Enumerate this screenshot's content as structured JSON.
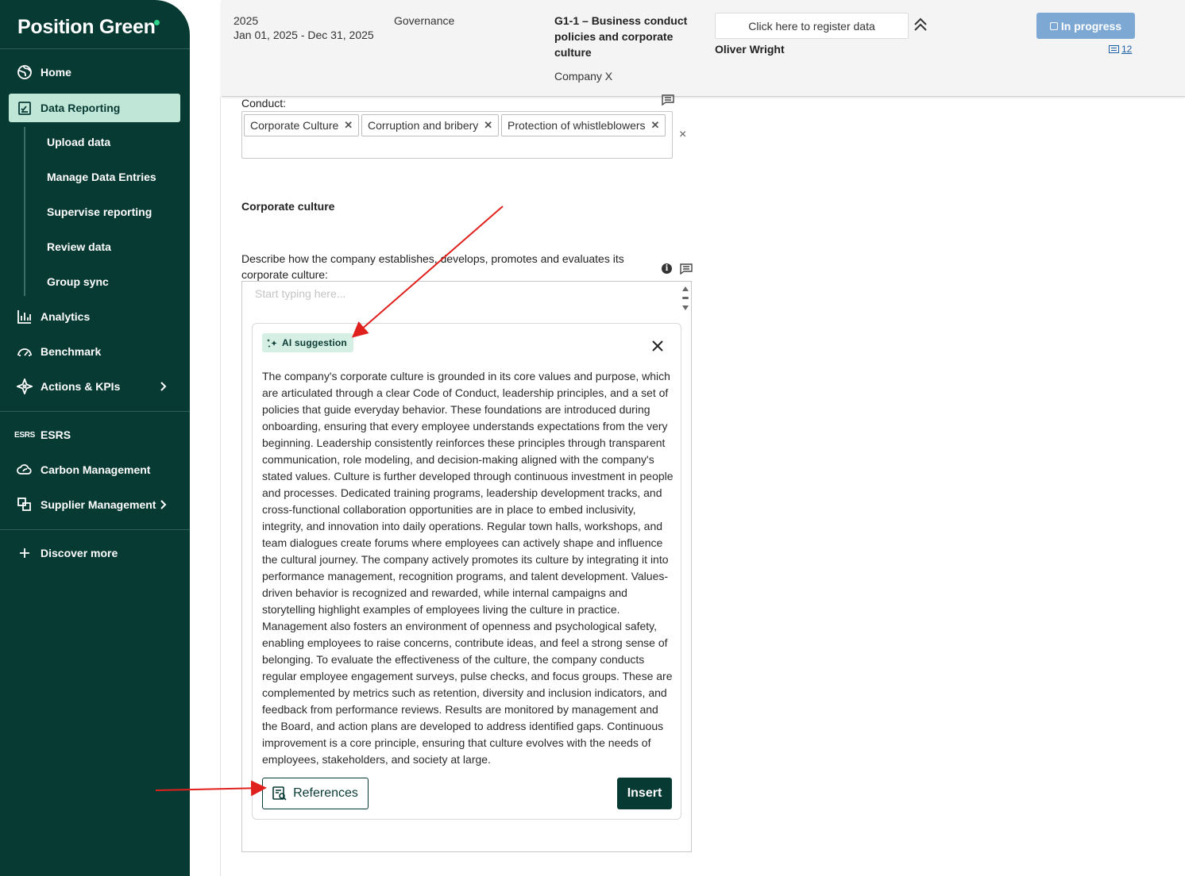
{
  "brand": {
    "name": "Position Green"
  },
  "nav": {
    "home": "Home",
    "data_reporting": "Data Reporting",
    "sub": [
      "Upload data",
      "Manage Data Entries",
      "Supervise reporting",
      "Review data",
      "Group sync"
    ],
    "analytics": "Analytics",
    "benchmark": "Benchmark",
    "actions": "Actions & KPIs",
    "esrs_mark": "ESRS",
    "esrs": "ESRS",
    "carbon": "Carbon Management",
    "supplier": "Supplier Management",
    "discover": "Discover more"
  },
  "header": {
    "year": "2025",
    "period": "Jan 01, 2025 - Dec 31, 2025",
    "topic": "Governance",
    "title": "G1-1 – Business conduct policies and corporate culture",
    "company": "Company X",
    "register_label": "Click here to register data",
    "user": "Oliver Wright",
    "status": "In progress",
    "comments": "12"
  },
  "form": {
    "conduct_label": "Conduct:",
    "tags": [
      "Corporate Culture",
      "Corruption and bribery",
      "Protection of whistleblowers"
    ],
    "clear": "×",
    "section_title": "Corporate culture",
    "question": "Describe how the company establishes, develops, promotes and evaluates its corporate culture:",
    "info": "i",
    "placeholder": "Start typing here..."
  },
  "ai": {
    "badge": "AI suggestion",
    "text": "The company's corporate culture is grounded in its core values and purpose, which are articulated through a clear Code of Conduct, leadership principles, and a set of policies that guide everyday behavior. These foundations are introduced during onboarding, ensuring that every employee understands expectations from the very beginning. Leadership consistently reinforces these principles through transparent communication, role modeling, and decision-making aligned with the company's stated values. Culture is further developed through continuous investment in people and processes. Dedicated training programs, leadership development tracks, and cross-functional collaboration opportunities are in place to embed inclusivity, integrity, and innovation into daily operations. Regular town halls, workshops, and team dialogues create forums where employees can actively shape and influence the cultural journey. The company actively promotes its culture by integrating it into performance management, recognition programs, and talent development. Values-driven behavior is recognized and rewarded, while internal campaigns and storytelling highlight examples of employees living the culture in practice. Management also fosters an environment of openness and psychological safety, enabling employees to raise concerns, contribute ideas, and feel a strong sense of belonging. To evaluate the effectiveness of the culture, the company conducts regular employee engagement surveys, pulse checks, and focus groups. These are complemented by metrics such as retention, diversity and inclusion indicators, and feedback from performance reviews. Results are monitored by management and the Board, and action plans are developed to address identified gaps. Continuous improvement is a core principle, ensuring that culture evolves with the needs of employees, stakeholders, and society at large.",
    "references": "References",
    "insert": "Insert"
  },
  "colors": {
    "sidebar": "#083a34",
    "active": "#bfe6d6",
    "status": "#7da8d4",
    "annotation": "#e0201c"
  }
}
